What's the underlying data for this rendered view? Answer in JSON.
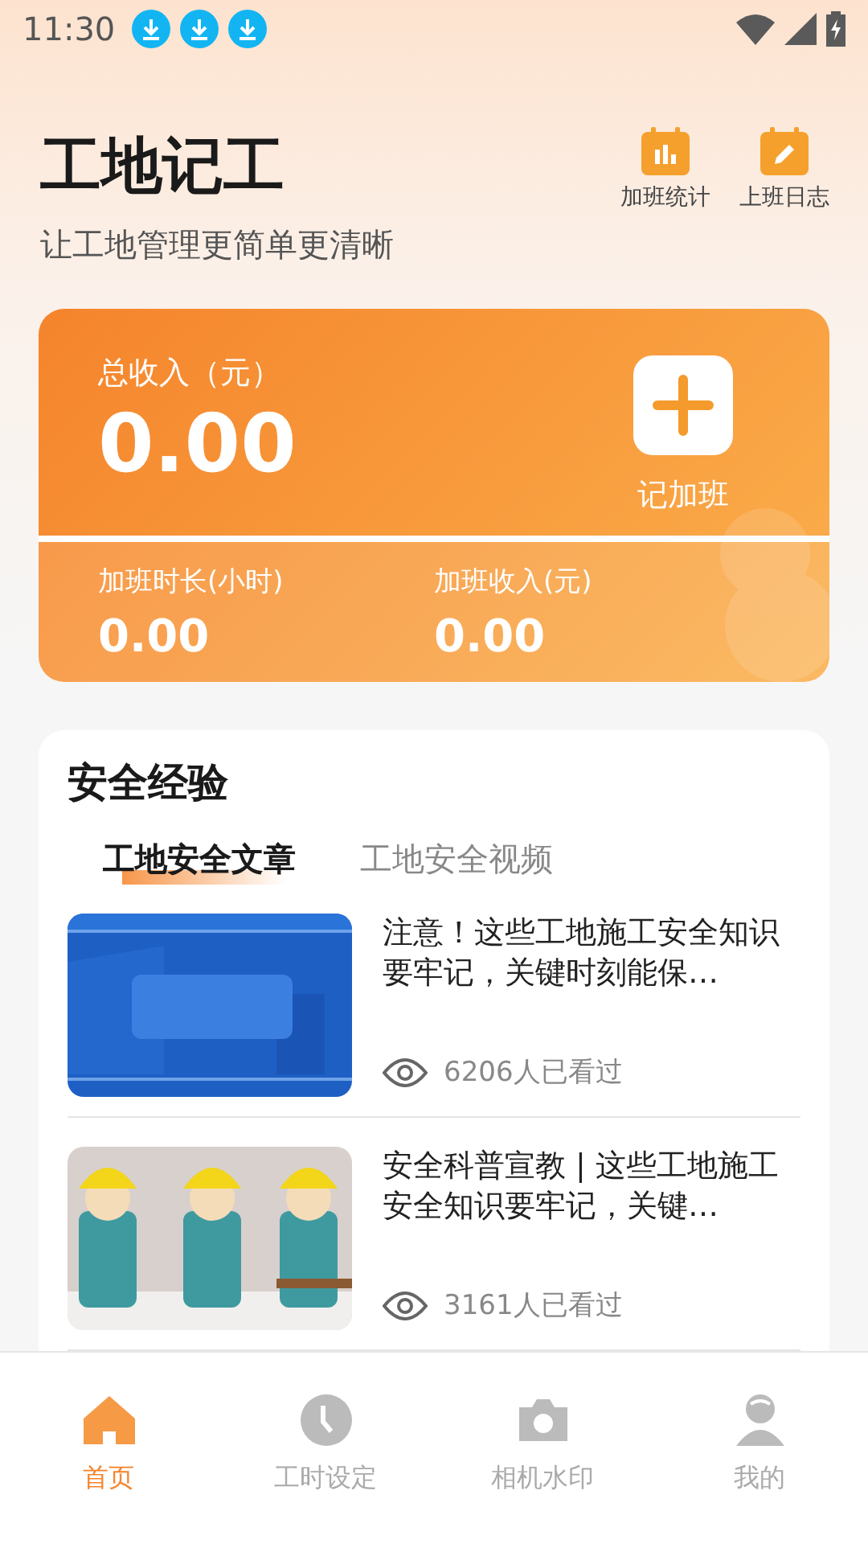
{
  "status_bar": {
    "time": "11:30",
    "notifications": [
      {
        "kind": "download"
      },
      {
        "kind": "download"
      },
      {
        "kind": "download"
      }
    ]
  },
  "header": {
    "title": "工地记工",
    "subtitle": "让工地管理更简单更清晰",
    "actions": [
      {
        "label": "加班统计"
      },
      {
        "label": "上班日志"
      }
    ]
  },
  "summary": {
    "total_label": "总收入（元）",
    "total_value": "0.00",
    "add_label": "记加班",
    "stats": [
      {
        "label": "加班时长(小时)",
        "value": "0.00"
      },
      {
        "label": "加班收入(元)",
        "value": "0.00"
      }
    ]
  },
  "safety": {
    "title": "安全经验",
    "tabs": [
      {
        "label": "工地安全文章",
        "selected": true
      },
      {
        "label": "工地安全视频",
        "selected": false
      }
    ],
    "articles": [
      {
        "kind": "picture",
        "title": "注意！这些工地施工安全知识要牢记，关键时刻能保…",
        "views": "6206人已看过"
      },
      {
        "kind": "picture",
        "title": "安全科普宣教 | 这些工地施工安全知识要牢记，关键…",
        "views": "3161人已看过"
      }
    ]
  },
  "tab_bar": [
    {
      "label": "首页",
      "selected": true
    },
    {
      "label": "工时设定",
      "selected": false
    },
    {
      "label": "相机水印",
      "selected": false
    },
    {
      "label": "我的",
      "selected": false
    }
  ]
}
